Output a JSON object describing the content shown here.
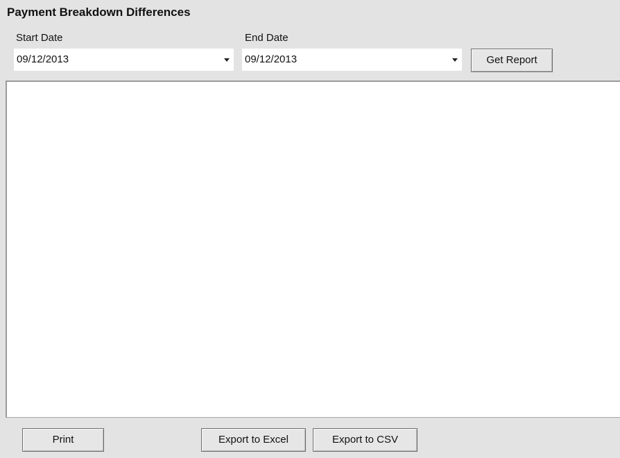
{
  "title": "Payment Breakdown Differences",
  "start_date": {
    "label": "Start Date",
    "value": "09/12/2013"
  },
  "end_date": {
    "label": "End Date",
    "value": "09/12/2013"
  },
  "buttons": {
    "get_report": "Get Report",
    "print": "Print",
    "export_excel": "Export to Excel",
    "export_csv": "Export to CSV"
  },
  "colors": {
    "window_background": "#e3e3e3",
    "report_background": "#ffffff",
    "button_border": "#6d6d6d"
  },
  "icons": {
    "dropdown": "chevron-down-icon"
  }
}
